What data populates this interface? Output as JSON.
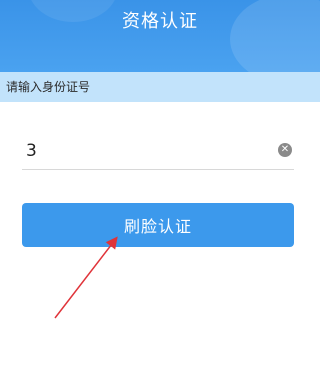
{
  "header": {
    "title": "资格认证"
  },
  "hint": {
    "text": "请输入身份证号"
  },
  "id_input": {
    "value": "3"
  },
  "buttons": {
    "face_verify": "刷脸认证"
  },
  "colors": {
    "primary": "#3c99ec",
    "hint_bg": "#c2e3fb",
    "annotation_arrow": "#e0343a"
  },
  "icons": {
    "clear": "clear-circle-icon"
  }
}
